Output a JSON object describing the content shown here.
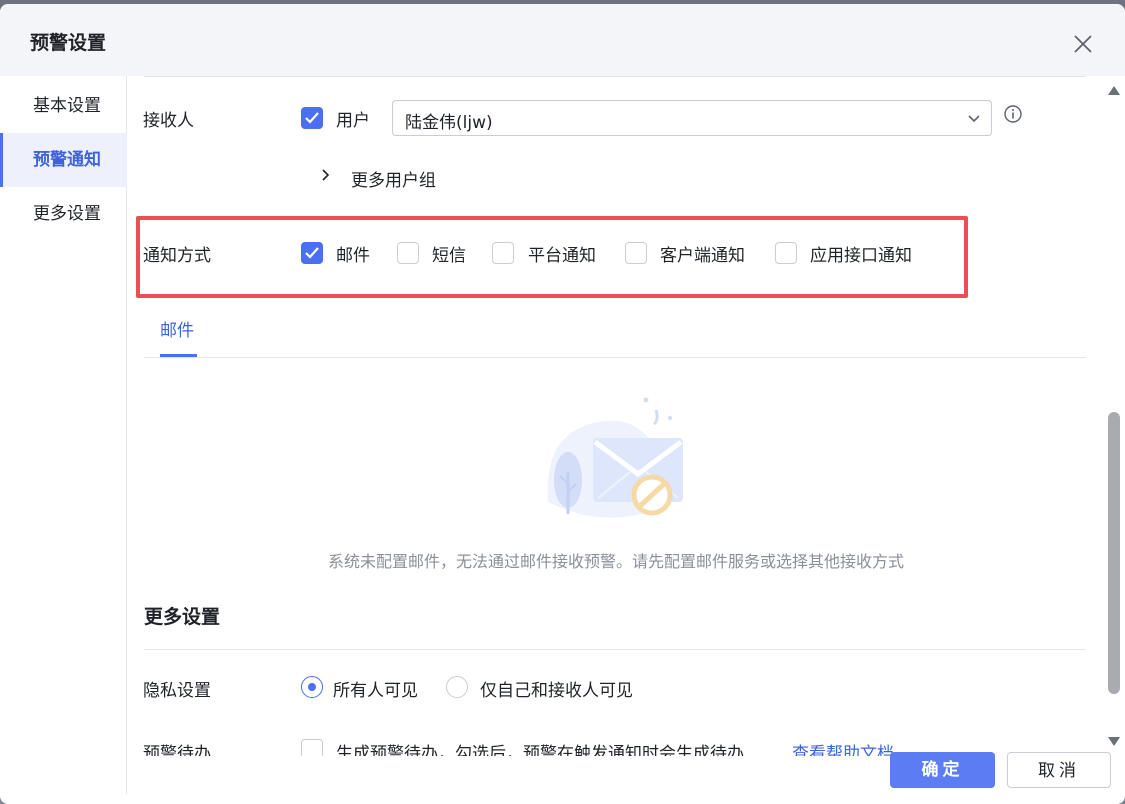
{
  "dialog": {
    "title": "预警设置"
  },
  "sidebar": {
    "items": [
      {
        "label": "基本设置",
        "active": false
      },
      {
        "label": "预警通知",
        "active": true
      },
      {
        "label": "更多设置",
        "active": false
      }
    ]
  },
  "receiver": {
    "label": "接收人",
    "user_checkbox_label": "用户",
    "user_checked": true,
    "selected_user": "陆金伟(ljw)",
    "more_groups_label": "更多用户组"
  },
  "notify_method": {
    "label": "通知方式",
    "options": [
      {
        "label": "邮件",
        "checked": true
      },
      {
        "label": "短信",
        "checked": false
      },
      {
        "label": "平台通知",
        "checked": false
      },
      {
        "label": "客户端通知",
        "checked": false
      },
      {
        "label": "应用接口通知",
        "checked": false
      }
    ]
  },
  "tabs": {
    "active": "邮件"
  },
  "empty_state": {
    "message": "系统未配置邮件，无法通过邮件接收预警。请先配置邮件服务或选择其他接收方式"
  },
  "more_settings": {
    "title": "更多设置",
    "privacy_label": "隐私设置",
    "privacy_options": [
      {
        "label": "所有人可见",
        "checked": true
      },
      {
        "label": "仅自己和接收人可见",
        "checked": false
      }
    ],
    "todo_label": "预警待办",
    "todo_checkbox_label": "生成预警待办，勾选后，预警在触发通知时会生成待办",
    "help_link": "查看帮助文档"
  },
  "footer": {
    "confirm_label": "确定",
    "cancel_label": "取消"
  },
  "colors": {
    "accent": "#4a6ff1",
    "highlight": "#ef4d55",
    "link": "#3e63dd"
  }
}
